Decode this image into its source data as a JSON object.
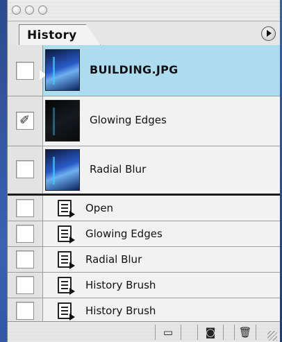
{
  "panel": {
    "tab_label": "History"
  },
  "snapshots": [
    {
      "label": "BUILDING.JPG",
      "selected": true,
      "source_brush": false,
      "thumbnail": "building-thumbnail"
    },
    {
      "label": "Glowing Edges",
      "selected": false,
      "source_brush": true,
      "thumbnail": "glowing-edges-thumbnail"
    },
    {
      "label": "Radial Blur",
      "selected": false,
      "source_brush": false,
      "thumbnail": "radial-blur-thumbnail"
    }
  ],
  "states": [
    {
      "label": "Open"
    },
    {
      "label": "Glowing Edges"
    },
    {
      "label": "Radial Blur"
    },
    {
      "label": "History Brush"
    },
    {
      "label": "History Brush"
    }
  ],
  "bottom_buttons": [
    {
      "icon": "new-document-icon",
      "glyph": "▭"
    },
    {
      "icon": "camera-icon",
      "glyph": "◙"
    },
    {
      "icon": "trash-icon",
      "glyph": "🗑"
    }
  ],
  "colors": {
    "selected_row": "#aedcef",
    "panel_bg": "#ededed"
  }
}
